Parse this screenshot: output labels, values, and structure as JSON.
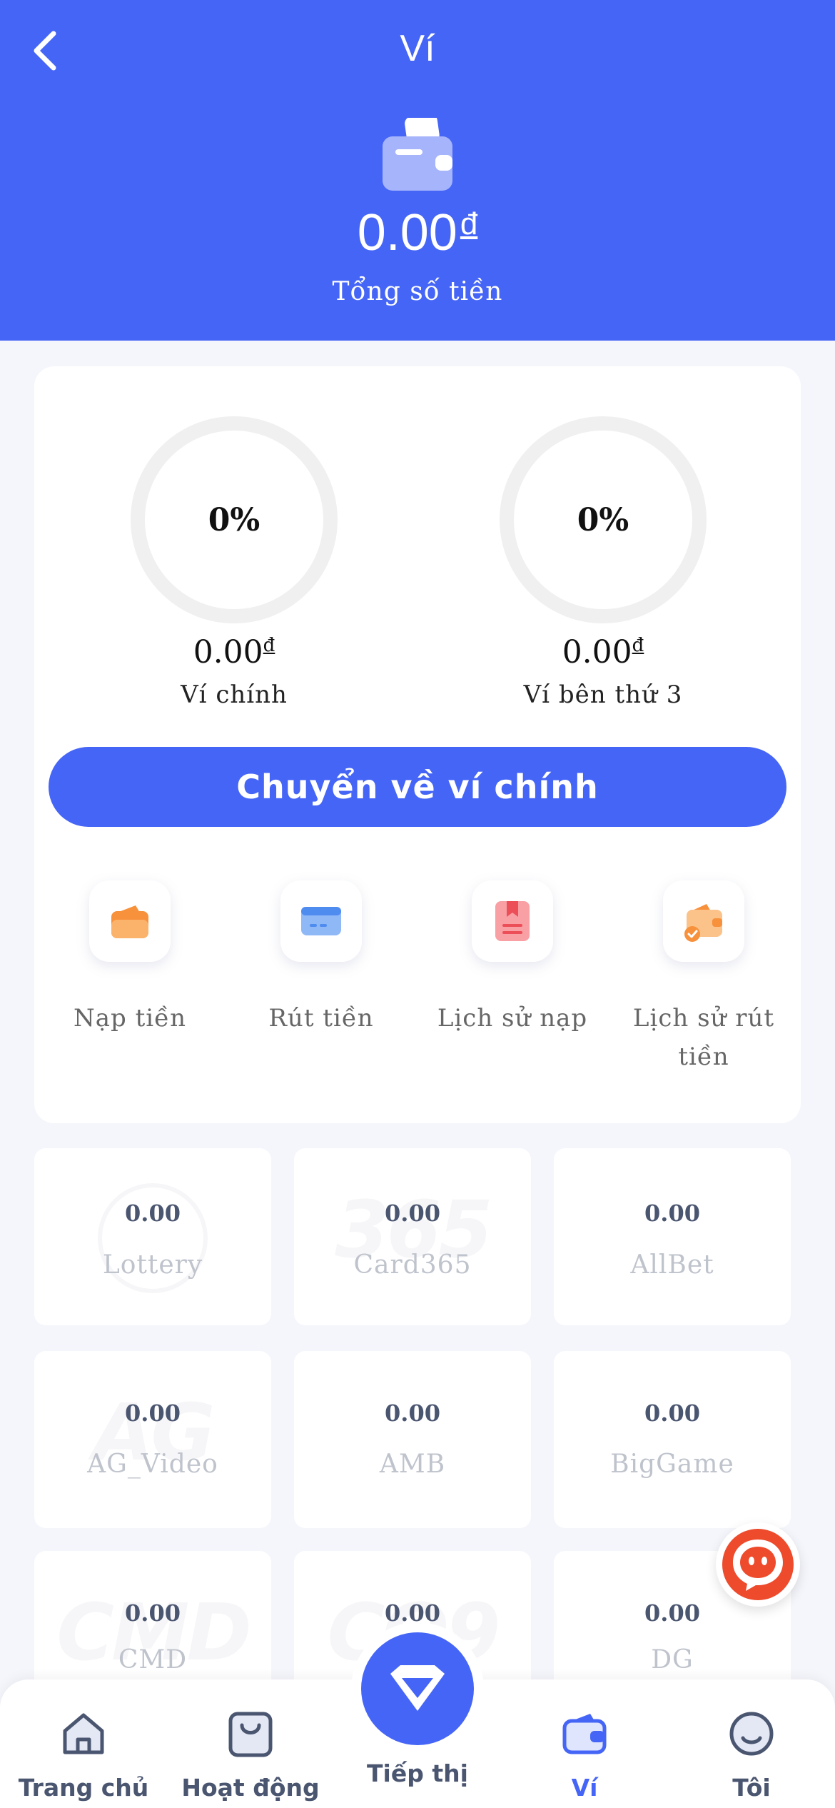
{
  "header": {
    "title": "Ví",
    "total_amount": "0.00",
    "currency": "đ",
    "total_label": "Tổng số tiền"
  },
  "wallets": {
    "main": {
      "percent": "0%",
      "amount": "0.00",
      "currency": "đ",
      "label": "Ví chính"
    },
    "third_party": {
      "percent": "0%",
      "amount": "0.00",
      "currency": "đ",
      "label": "Ví bên thứ 3"
    }
  },
  "transfer_button": "Chuyển về ví chính",
  "actions": [
    {
      "label": "Nạp tiền",
      "icon": "deposit-wallet-icon"
    },
    {
      "label": "Rút tiền",
      "icon": "card-icon"
    },
    {
      "label": "Lịch sử nạp",
      "icon": "deposit-history-icon"
    },
    {
      "label": "Lịch sử rút tiền",
      "icon": "withdraw-history-icon"
    }
  ],
  "games": [
    {
      "value": "0.00",
      "name": "Lottery",
      "watermark": ""
    },
    {
      "value": "0.00",
      "name": "Card365",
      "watermark": "365"
    },
    {
      "value": "0.00",
      "name": "AllBet",
      "watermark": ""
    },
    {
      "value": "0.00",
      "name": "AG_Video",
      "watermark": "AG"
    },
    {
      "value": "0.00",
      "name": "AMB",
      "watermark": ""
    },
    {
      "value": "0.00",
      "name": "BigGame",
      "watermark": ""
    },
    {
      "value": "0.00",
      "name": "CMD",
      "watermark": "CMD"
    },
    {
      "value": "0.00",
      "name": "",
      "watermark": "CQ9"
    },
    {
      "value": "0.00",
      "name": "DG",
      "watermark": ""
    }
  ],
  "tabbar": [
    {
      "label": "Trang chủ",
      "icon": "home-icon"
    },
    {
      "label": "Hoạt động",
      "icon": "gift-bag-icon"
    },
    {
      "label": "Tiếp thị",
      "icon": "diamond-icon"
    },
    {
      "label": "Ví",
      "icon": "wallet-icon",
      "active": true
    },
    {
      "label": "Tôi",
      "icon": "profile-icon"
    }
  ],
  "colors": {
    "primary": "#4565f6",
    "background": "#f5f6fb",
    "orange": "#f7913c"
  }
}
